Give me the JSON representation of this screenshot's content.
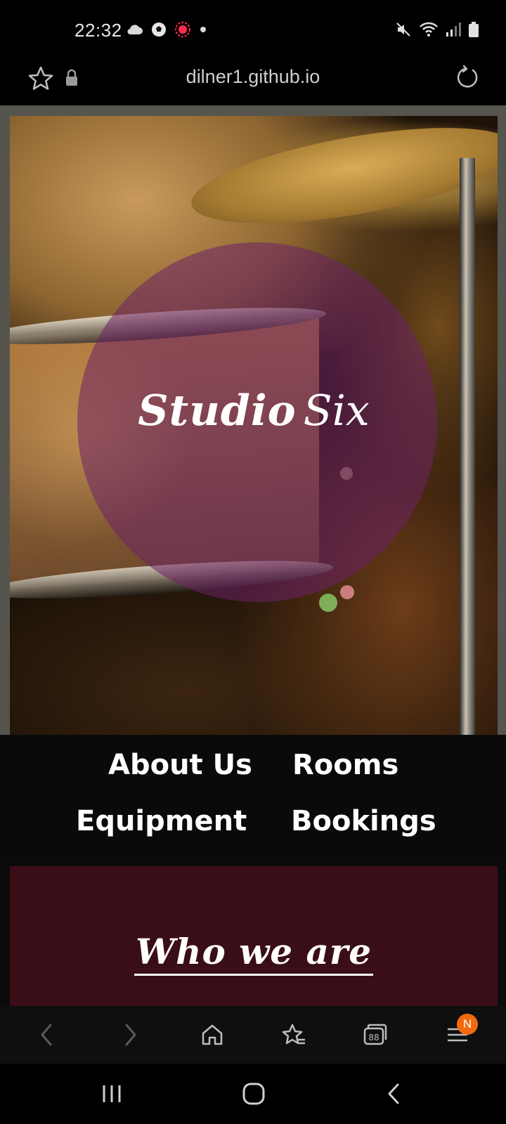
{
  "status_bar": {
    "time": "22:32",
    "left_icons": [
      "cloud-icon",
      "soccer-ball-icon",
      "recording-icon",
      "dot-icon"
    ],
    "right_icons": [
      "mute-icon",
      "wifi-icon",
      "signal-icon",
      "battery-icon"
    ]
  },
  "browser": {
    "url": "dilner1.github.io",
    "icons": [
      "star-icon",
      "lock-icon",
      "reload-icon"
    ]
  },
  "hero": {
    "title_bold": "Studio",
    "title_light": "Six"
  },
  "nav": {
    "about": "About Us",
    "rooms": "Rooms",
    "equipment": "Equipment",
    "bookings": "Bookings"
  },
  "who": {
    "heading": "Who we are"
  },
  "toolbar": {
    "badge": "N",
    "icons": [
      "back-icon",
      "forward-icon",
      "home-icon",
      "bookmarks-icon",
      "tabs-icon",
      "menu-icon"
    ]
  },
  "system_nav": {
    "icons": [
      "recents-icon",
      "home-icon",
      "back-icon"
    ]
  },
  "colors": {
    "hero_frame": "#55554d",
    "title_circle": "#6e2364",
    "nav_bg": "#0a0a0a",
    "who_bg": "#3a0e16",
    "badge": "#f26a10"
  }
}
